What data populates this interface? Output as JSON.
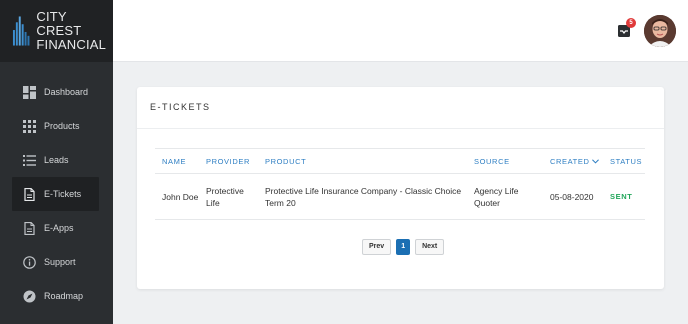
{
  "brand": {
    "line1": "CITY CREST",
    "line2": "FINANCIAL"
  },
  "sidebar": {
    "items": [
      {
        "label": "Dashboard",
        "icon": "dashboard-icon"
      },
      {
        "label": "Products",
        "icon": "grid-icon"
      },
      {
        "label": "Leads",
        "icon": "list-icon"
      },
      {
        "label": "E-Tickets",
        "icon": "document-icon",
        "active": true
      },
      {
        "label": "E-Apps",
        "icon": "document-icon"
      },
      {
        "label": "Support",
        "icon": "info-icon"
      },
      {
        "label": "Roadmap",
        "icon": "compass-icon"
      }
    ]
  },
  "topbar": {
    "notification_count": "5"
  },
  "card": {
    "title": "E-TICKETS",
    "columns": [
      "NAME",
      "PROVIDER",
      "PRODUCT",
      "SOURCE",
      "CREATED",
      "STATUS"
    ],
    "rows": [
      {
        "name": "John Doe",
        "provider": "Protective Life",
        "product": "Protective Life Insurance Company - Classic Choice Term 20",
        "source": "Agency Life Quoter",
        "created": "05-08-2020",
        "status": "SENT"
      }
    ],
    "pagination": {
      "prev": "Prev",
      "current": "1",
      "next": "Next"
    }
  },
  "colors": {
    "accent": "#2f7fc3",
    "status_sent": "#21a65a",
    "sidebar_bg": "#2b2e31",
    "badge": "#e03a3a"
  }
}
